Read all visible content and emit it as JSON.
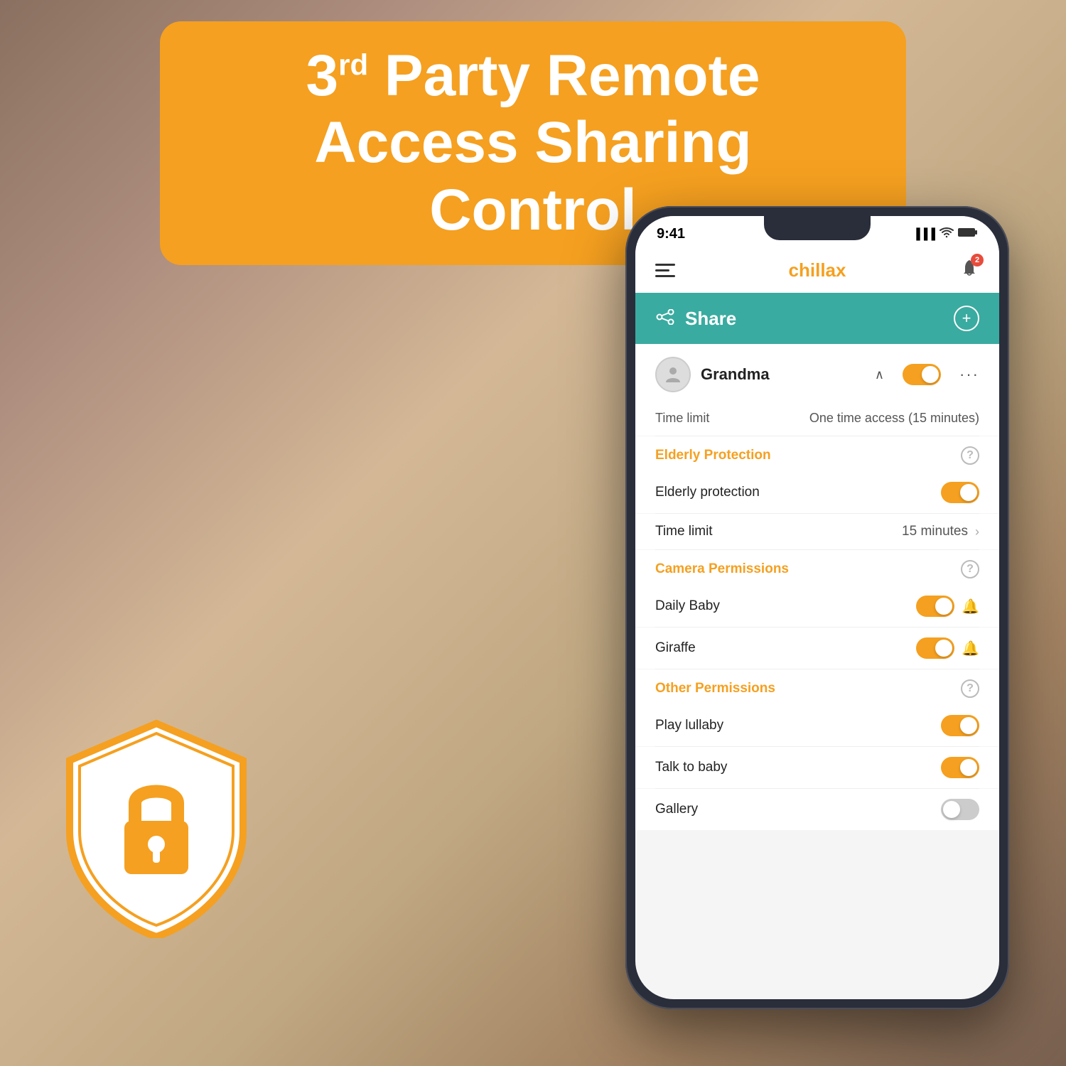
{
  "header": {
    "line1": "3",
    "superscript": "rd",
    "line2": " Party Remote",
    "line3": "Access Sharing Control"
  },
  "phone": {
    "status": {
      "time": "9:41",
      "signal_bars": "▌▌▌",
      "wifi": "WiFi",
      "battery": "🔋",
      "notification_count": "2"
    },
    "app_name": "chillax",
    "share_title": "Share",
    "user": {
      "name": "Grandma",
      "time_limit_label": "Time limit",
      "time_limit_value": "One time access (15 minutes)"
    },
    "sections": [
      {
        "id": "elderly",
        "title": "Elderly Protection",
        "items": [
          {
            "label": "Elderly protection",
            "type": "toggle",
            "state": "on"
          },
          {
            "label": "Time limit",
            "value": "15 minutes",
            "type": "chevron"
          }
        ]
      },
      {
        "id": "camera",
        "title": "Camera Permissions",
        "items": [
          {
            "label": "Daily Baby",
            "type": "toggle-bell",
            "state": "on"
          },
          {
            "label": "Giraffe",
            "type": "toggle-bell",
            "state": "on"
          }
        ]
      },
      {
        "id": "other",
        "title": "Other Permissions",
        "items": [
          {
            "label": "Play lullaby",
            "type": "toggle",
            "state": "on"
          },
          {
            "label": "Talk to baby",
            "type": "toggle",
            "state": "on"
          },
          {
            "label": "Gallery",
            "type": "toggle",
            "state": "off"
          }
        ]
      }
    ]
  },
  "shield": {
    "description": "Security shield icon"
  }
}
